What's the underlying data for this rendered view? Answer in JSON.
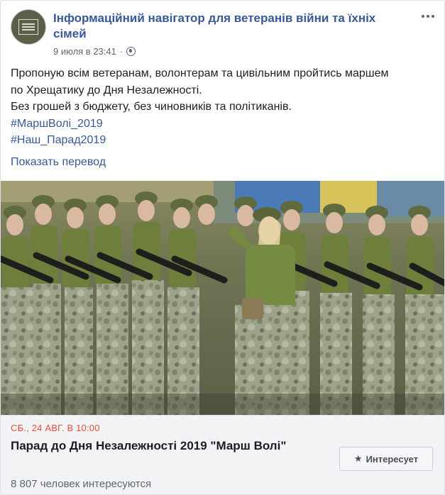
{
  "post": {
    "page_name": "Інформаційний навігатор для ветеранів війни та їхніх сімей",
    "timestamp": "9 июля в 23:41",
    "separator": "·",
    "privacy_icon": "globe-icon",
    "more_icon": "more-options-icon",
    "text_lines": [
      "Пропоную всім ветеранам, волонтерам та цивільним пройтись маршем",
      "по Хрещатику до Дня Незалежності.",
      "Без грошей з бюджету, без чиновників та політиканів."
    ],
    "hashtags": [
      "#МаршВолі_2019",
      "#Наш_Парад2019"
    ],
    "translate_link": "Показать перевод"
  },
  "event": {
    "date": "СБ., 24 АВГ. В 10:00",
    "title": "Парад до Дня Незалежності 2019 \"Марш Волі\"",
    "interest_button": "Интересует",
    "interest_icon": "star-icon",
    "interested_count": "8 807 человек интересуются"
  },
  "colors": {
    "link": "#385898",
    "date": "#e64c3c",
    "muted": "#606770",
    "event_bg": "#f2f3f5"
  }
}
